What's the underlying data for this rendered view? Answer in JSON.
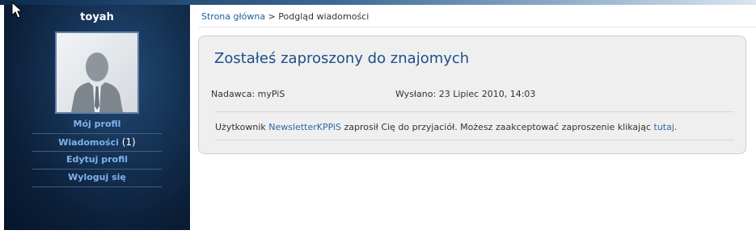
{
  "sidebar": {
    "username": "toyah",
    "avatar_icon": "default-user-silhouette",
    "menu": {
      "profile": "Mój profil",
      "messages": "Wiadomości",
      "messages_count": "(1)",
      "edit_profile": "Edytuj profil",
      "logout": "Wyloguj się"
    }
  },
  "breadcrumb": {
    "home": "Strona główna",
    "separator": ">",
    "current": "Podgląd wiadomości"
  },
  "message": {
    "title": "Zostałeś zaproszony do znajomych",
    "sender": "Nadawca: myPiS",
    "sent": "Wysłano: 23 Lipiec 2010, 14:03",
    "body_prefix": "Użytkownik",
    "body_user": "NewsletterKPPiS",
    "body_middle": "zaprosił Cię do przyjaciół. Możesz zaakceptować zaproszenie klikając",
    "body_link": "tutaj",
    "body_suffix": "."
  },
  "colors": {
    "sidebar_bg": "#0b1f38",
    "menu_link": "#7fb2ec",
    "title": "#1c4f8a",
    "link": "#2c68a8"
  }
}
